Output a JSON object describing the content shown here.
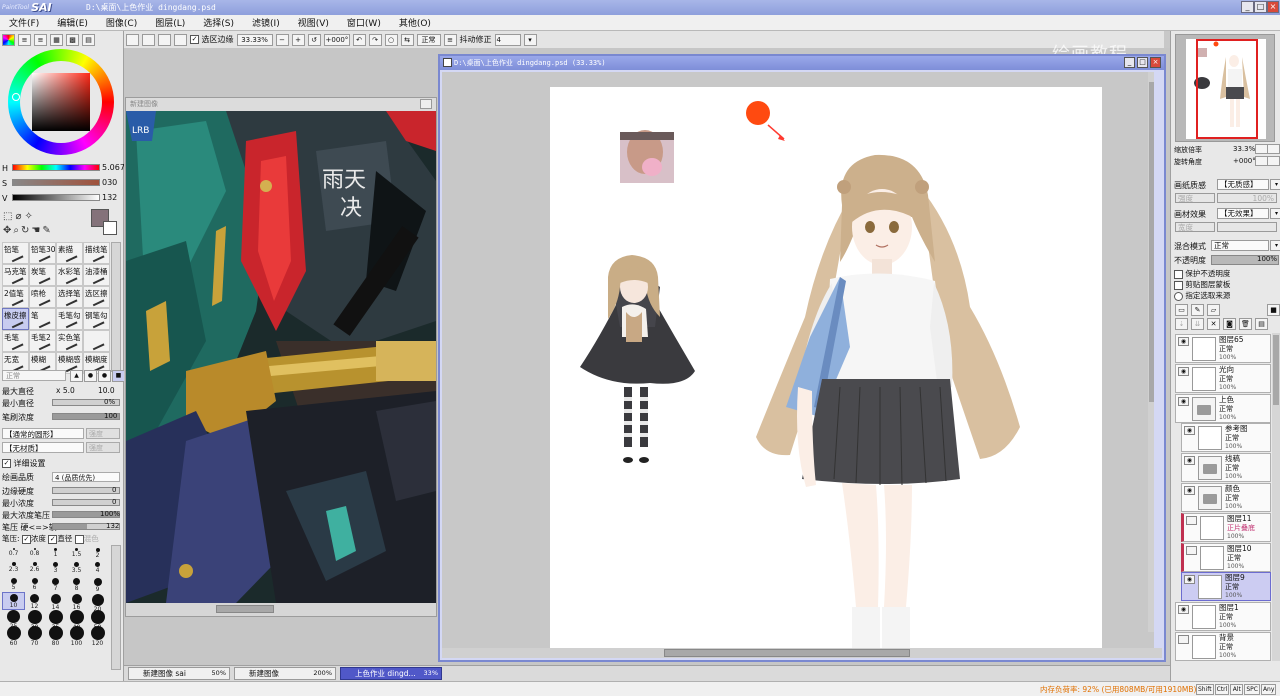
{
  "title_bar": {
    "app_logo_small": "PaintTool",
    "app_logo": "SAI",
    "document_path": "D:\\桌面\\上色作业 dingdang.psd",
    "buttons": [
      "_",
      "□",
      "×"
    ]
  },
  "menu": [
    "文件(F)",
    "编辑(E)",
    "图像(C)",
    "图层(L)",
    "选择(S)",
    "滤镜(I)",
    "视图(V)",
    "窗口(W)",
    "其他(O)"
  ],
  "toolbar": {
    "selection_edge_label": "选区边缘",
    "zoom": "33.33%",
    "rotation": "+000°",
    "blend_mode": "正常",
    "stabilizer_label": "抖动修正",
    "stabilizer_value": "4"
  },
  "watermark": "绘画教程",
  "color_panel": {
    "h_label": "H",
    "h_value": "5.067",
    "s_label": "S",
    "s_value": "030",
    "v_label": "V",
    "v_value": "132",
    "h_fraction": 0.014,
    "s_fraction": 0.12,
    "v_fraction": 0.52,
    "current_color": "#84727a"
  },
  "tools": [
    "铅笔",
    "铅笔30",
    "素描",
    "描线笔",
    "马克笔",
    "炭笔",
    "水彩笔",
    "油漆桶",
    "2值笔",
    "喷枪",
    "选择笔",
    "选区擦",
    "橡皮擦",
    "笔",
    "毛笔勾",
    "钢笔勾",
    "毛笔",
    "毛笔2",
    "实色笔",
    "",
    "无宽",
    "模糊",
    "模糊感",
    "模糊度"
  ],
  "selected_tool_index": 12,
  "brush_settings": {
    "mode": "正常",
    "max_size_label": "最大直径",
    "size_multiplier": "x 5.0",
    "max_size_value": "10.0",
    "min_size_label": "最小直径",
    "min_size_value": "0%",
    "density_label": "笔刷浓度",
    "density_value": "100",
    "shape_label": "【通常的圆形】",
    "shape_strength": "强度",
    "texture_label": "【无材质】",
    "texture_strength": "强度",
    "detail_label": "详细设置",
    "quality_label": "绘画品质",
    "quality_value": "4 (品质优先)",
    "edge_hardness_label": "边缘硬度",
    "edge_hardness_value": "0",
    "min_density_label": "最小浓度",
    "min_density_value": "0",
    "max_density_pressure_label": "最大浓度笔压",
    "max_density_pressure_value": "100%",
    "pressure_hardness_label": "笔压 硬<=>软",
    "pressure_hardness_value": "132",
    "pressure_label": "笔压:",
    "pressure_density": "浓度",
    "pressure_size": "直径",
    "pressure_blend": "混色"
  },
  "brush_sizes": [
    "0.7",
    "0.8",
    "1",
    "1.5",
    "2",
    "2.3",
    "2.6",
    "3",
    "3.5",
    "4",
    "5",
    "6",
    "7",
    "8",
    "9",
    "10",
    "12",
    "14",
    "16",
    "20",
    "25",
    "30",
    "35",
    "40",
    "50",
    "60",
    "70",
    "80",
    "100",
    "120"
  ],
  "selected_brush_size_index": 15,
  "subwindow": {
    "title": "新建图像",
    "art_text": [
      "雨天",
      "决"
    ],
    "badge_text": "LRB"
  },
  "main_window": {
    "title": "D:\\桌面\\上色作业 dingdang.psd (33.33%)"
  },
  "navigator": {
    "zoom_label": "缩放倍率",
    "zoom_value": "33.3%",
    "rotate_label": "旋转角度",
    "rotate_value": "+000°"
  },
  "layer_panel": {
    "paper_texture_label": "画纸质感",
    "paper_texture_value": "【无质感】",
    "paper_texture_strength": "强度",
    "paper_texture_pct": "100%",
    "effect_label": "画材效果",
    "effect_value": "【无效果】",
    "effect_strength": "宽度",
    "blend_label": "混合模式",
    "blend_value": "正常",
    "opacity_label": "不透明度",
    "opacity_value": "100%",
    "opacity_fraction": 1.0,
    "protect_opacity": "保护不透明度",
    "clip_group": "剪贴图层蒙板",
    "selection_source": "指定选取来源"
  },
  "layers": [
    {
      "name": "图层65",
      "mode": "正常",
      "opacity": "100%",
      "kind": "layer",
      "indent": 0,
      "visible": true
    },
    {
      "name": "光向",
      "mode": "正常",
      "opacity": "100%",
      "kind": "layer",
      "indent": 0,
      "visible": true
    },
    {
      "name": "上色",
      "mode": "正常",
      "opacity": "100%",
      "kind": "folder",
      "indent": 0,
      "visible": true
    },
    {
      "name": "参考图",
      "mode": "正常",
      "opacity": "100%",
      "kind": "layer",
      "indent": 1,
      "visible": true
    },
    {
      "name": "线稿",
      "mode": "正常",
      "opacity": "100%",
      "kind": "folder",
      "indent": 1,
      "visible": true
    },
    {
      "name": "颜色",
      "mode": "正常",
      "opacity": "100%",
      "kind": "folder",
      "indent": 1,
      "visible": true
    },
    {
      "name": "图层11",
      "mode": "正片叠底",
      "opacity": "100%",
      "kind": "layer",
      "indent": 1,
      "visible": false,
      "clip": true
    },
    {
      "name": "图层10",
      "mode": "正常",
      "opacity": "100%",
      "kind": "layer",
      "indent": 1,
      "visible": false,
      "clip": true
    },
    {
      "name": "图层9",
      "mode": "正常",
      "opacity": "100%",
      "kind": "layer",
      "indent": 1,
      "visible": true,
      "selected": true
    },
    {
      "name": "图层1",
      "mode": "正常",
      "opacity": "100%",
      "kind": "layer",
      "indent": 0,
      "visible": true
    },
    {
      "name": "背景",
      "mode": "正常",
      "opacity": "100%",
      "kind": "layer",
      "indent": 0,
      "visible": false
    }
  ],
  "taskbar": [
    {
      "label": "新建图像 sai",
      "pct": "50%",
      "active": false
    },
    {
      "label": "新建图像",
      "pct": "200%",
      "active": false
    },
    {
      "label": "上色作业 dingd...",
      "pct": "33%",
      "active": true
    }
  ],
  "status": {
    "memory": "内存负荷率: 92% (已用808MB/可用1910MB)",
    "keys": [
      "Shift",
      "Ctrl",
      "Alt",
      "SPC",
      "Any"
    ]
  }
}
